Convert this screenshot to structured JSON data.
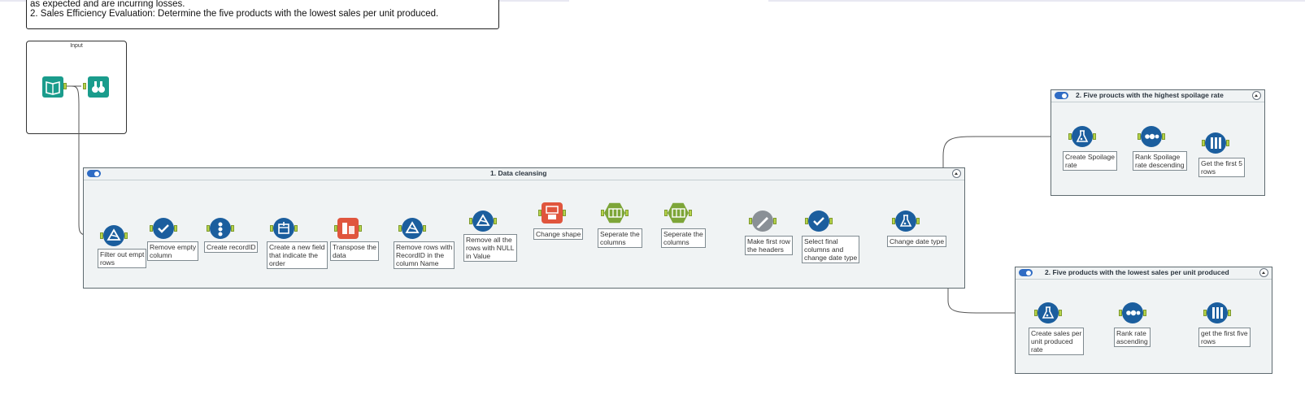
{
  "canvas": {
    "comment": {
      "line1": "as expected and are incurring losses.",
      "line2": "2. Sales Efficiency Evaluation: Determine the five products with the lowest sales per unit produced."
    },
    "input_container": {
      "title": "Input",
      "tools": [
        {
          "name": "input-data-tool",
          "icon": "book-icon",
          "color": "#1a9c8c"
        },
        {
          "name": "browse-tool",
          "icon": "binoculars-icon",
          "color": "#1a9c8c"
        }
      ]
    },
    "containers": [
      {
        "title": "1. Data cleansing",
        "tools": [
          {
            "label": "Filter out empty rows",
            "label_lines": [
              "Filter out empt",
              "rows"
            ],
            "icon": "filter-icon"
          },
          {
            "label": "Remove empty column",
            "label_lines": [
              "Remove empty",
              "column"
            ],
            "icon": "select-icon"
          },
          {
            "label": "Create recordID",
            "label_lines": [
              "Create recordID"
            ],
            "icon": "recordid-icon"
          },
          {
            "label": "Create a new field that indicate the order",
            "label_lines": [
              "Create a new field",
              "that indicate the",
              "order"
            ],
            "icon": "multirow-icon"
          },
          {
            "label": "Transpose the data",
            "label_lines": [
              "Transpose the",
              "data"
            ],
            "icon": "transpose-icon"
          },
          {
            "label": "Remove rows with RecordID in the column Name",
            "label_lines": [
              "Remove rows with",
              "RecordID in the",
              "column Name"
            ],
            "icon": "filter-icon"
          },
          {
            "label": "Remove all the rows with NULL in Value",
            "label_lines": [
              "Remove all the",
              "rows with NULL",
              "in Value"
            ],
            "icon": "filter-icon"
          },
          {
            "label": "Change shape",
            "label_lines": [
              "Change shape"
            ],
            "icon": "crosstab-icon"
          },
          {
            "label": "Seperate the columns",
            "label_lines": [
              "Seperate the",
              "columns"
            ],
            "icon": "text-to-columns-icon"
          },
          {
            "label": "Seperate the columns",
            "label_lines": [
              "Seperate the",
              "columns"
            ],
            "icon": "text-to-columns-icon"
          },
          {
            "label": "Make first row the headers",
            "label_lines": [
              "Make first row",
              "the headers"
            ],
            "icon": "dynamic-rename-icon"
          },
          {
            "label": "Select final columns and change date type",
            "label_lines": [
              "Select final",
              "columns and",
              "change date type"
            ],
            "icon": "select-icon"
          },
          {
            "label": "Change date type",
            "label_lines": [
              "Change date type"
            ],
            "icon": "formula-icon"
          }
        ]
      },
      {
        "title": "2. Five proucts with the highest spoilage rate",
        "tools": [
          {
            "label": "Create Spoilage rate",
            "label_lines": [
              "Create Spoilage",
              "rate"
            ],
            "icon": "formula-icon"
          },
          {
            "label": "Rank Spoilage rate descending",
            "label_lines": [
              "Rank Spoilage",
              "rate descending"
            ],
            "icon": "sort-icon"
          },
          {
            "label": "Get the first 5 rows",
            "label_lines": [
              "Get the first 5",
              "rows"
            ],
            "icon": "sample-icon"
          }
        ]
      },
      {
        "title": "2. Five products with the lowest sales per unit produced",
        "tools": [
          {
            "label": "Create sales per unit produced rate",
            "label_lines": [
              "Create sales per",
              "unit produced",
              "rate"
            ],
            "icon": "formula-icon"
          },
          {
            "label": "Rank rate ascending",
            "label_lines": [
              "Rank rate",
              "ascending"
            ],
            "icon": "sort-icon"
          },
          {
            "label": "get the first five rows",
            "label_lines": [
              "get the first five",
              "rows"
            ],
            "icon": "sample-icon"
          }
        ]
      }
    ]
  },
  "colors": {
    "tool_blue": "#1b5e9e",
    "tool_orange": "#e0553d",
    "tool_green": "#7da538",
    "tool_gray": "#8a9096",
    "tool_teal": "#1a9c8c",
    "port_green": "#b6d44a",
    "container_bg": "#f0f3f4"
  }
}
